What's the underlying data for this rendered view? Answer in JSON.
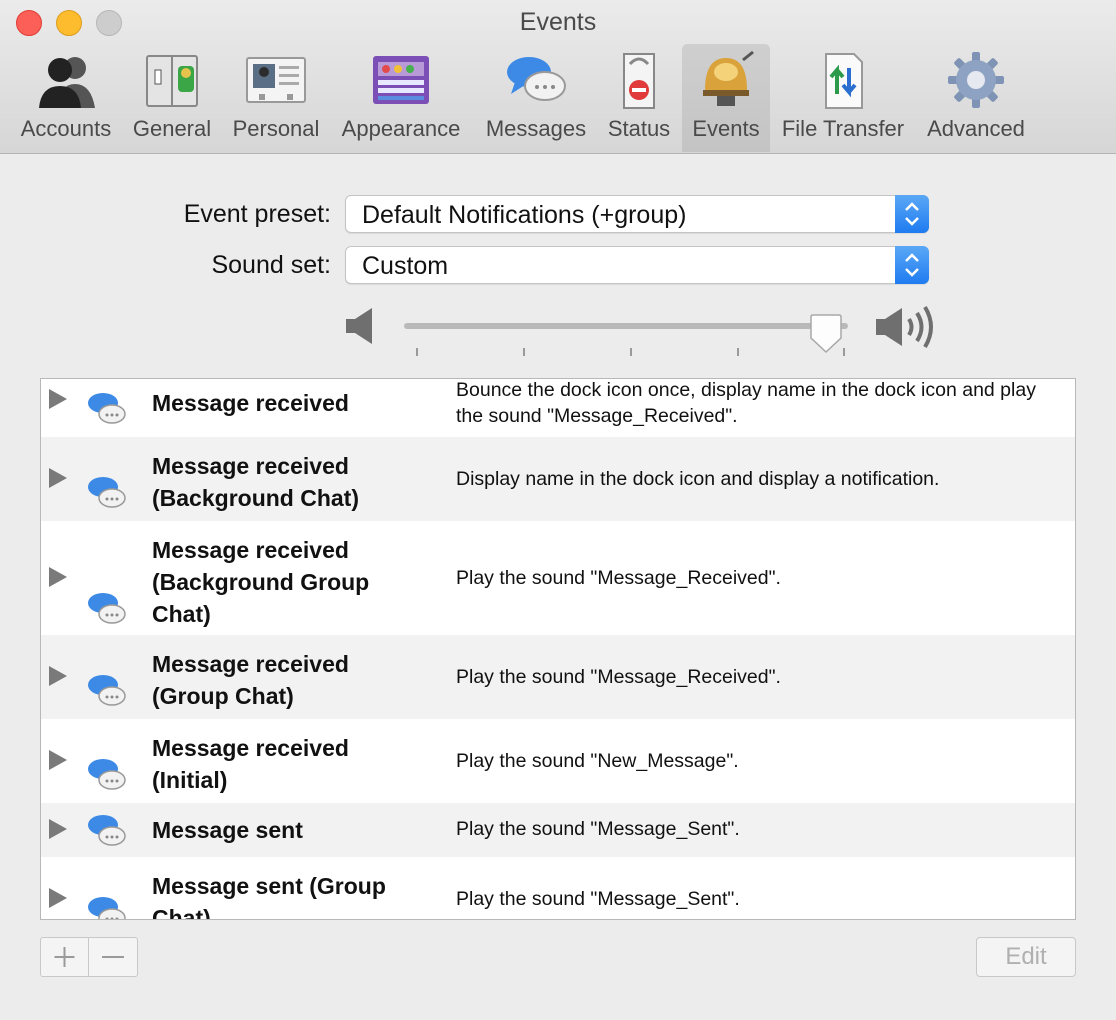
{
  "window": {
    "title": "Events"
  },
  "toolbar": {
    "tabs": [
      {
        "label": "Accounts",
        "icon": "accounts-icon"
      },
      {
        "label": "General",
        "icon": "general-icon"
      },
      {
        "label": "Personal",
        "icon": "personal-icon"
      },
      {
        "label": "Appearance",
        "icon": "appearance-icon"
      },
      {
        "label": "Messages",
        "icon": "messages-icon"
      },
      {
        "label": "Status",
        "icon": "status-icon"
      },
      {
        "label": "Events",
        "icon": "bell-icon",
        "selected": true
      },
      {
        "label": "File Transfer",
        "icon": "file-transfer-icon"
      },
      {
        "label": "Advanced",
        "icon": "gear-icon"
      }
    ]
  },
  "form": {
    "event_preset_label": "Event preset:",
    "event_preset_value": "Default Notifications (+group)",
    "sound_set_label": "Sound set:",
    "sound_set_value": "Custom",
    "volume": 0.95
  },
  "events": [
    {
      "name": "Message received",
      "description": "Bounce the dock icon once, display name in the dock icon and play the sound \"Message_Received\"."
    },
    {
      "name": "Message received (Background Chat)",
      "description": "Display name in the dock icon and display a notification."
    },
    {
      "name": "Message received (Background Group Chat)",
      "description": "Play the sound \"Message_Received\"."
    },
    {
      "name": "Message received (Group Chat)",
      "description": "Play the sound \"Message_Received\"."
    },
    {
      "name": "Message received (Initial)",
      "description": "Play the sound \"New_Message\"."
    },
    {
      "name": "Message sent",
      "description": "Play the sound \"Message_Sent\"."
    },
    {
      "name": "Message sent (Group Chat)",
      "description": "Play the sound \"Message_Sent\"."
    }
  ],
  "buttons": {
    "edit_label": "Edit"
  },
  "colors": {
    "accent": "#1f7bf0",
    "row_alt": "#f2f2f2",
    "close": "#fc5f57",
    "minimize": "#fdbc2e"
  }
}
